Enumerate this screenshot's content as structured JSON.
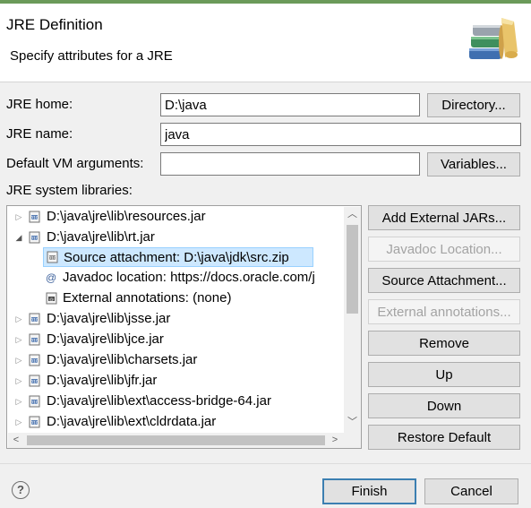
{
  "header": {
    "title": "JRE Definition",
    "subtitle": "Specify attributes for a JRE",
    "icon": "jre-books-icon"
  },
  "form": {
    "jre_home_label": "JRE home:",
    "jre_home_value": "D:\\java",
    "directory_button": "Directory...",
    "jre_name_label": "JRE name:",
    "jre_name_value": "java",
    "vm_args_label": "Default VM arguments:",
    "vm_args_value": "",
    "variables_button": "Variables..."
  },
  "libraries": {
    "label": "JRE system libraries:",
    "items": [
      {
        "text": "D:\\java\\jre\\lib\\resources.jar",
        "expanded": false
      },
      {
        "text": "D:\\java\\jre\\lib\\rt.jar",
        "expanded": true
      },
      {
        "text": "Source attachment: D:\\java\\jdk\\src.zip",
        "child": true,
        "selected": true
      },
      {
        "text": "Javadoc location: https://docs.oracle.com/j",
        "child": true
      },
      {
        "text": "External annotations: (none)",
        "child": true
      },
      {
        "text": "D:\\java\\jre\\lib\\jsse.jar",
        "expanded": false
      },
      {
        "text": "D:\\java\\jre\\lib\\jce.jar",
        "expanded": false
      },
      {
        "text": "D:\\java\\jre\\lib\\charsets.jar",
        "expanded": false
      },
      {
        "text": "D:\\java\\jre\\lib\\jfr.jar",
        "expanded": false
      },
      {
        "text": "D:\\java\\jre\\lib\\ext\\access-bridge-64.jar",
        "expanded": false
      },
      {
        "text": "D:\\java\\jre\\lib\\ext\\cldrdata.jar",
        "expanded": false
      }
    ]
  },
  "side_buttons": {
    "add_external_jars": "Add External JARs...",
    "javadoc_location": "Javadoc Location...",
    "source_attachment": "Source Attachment...",
    "external_annotations": "External annotations...",
    "remove": "Remove",
    "up": "Up",
    "down": "Down",
    "restore_default": "Restore Default"
  },
  "footer": {
    "help_icon": "help-icon",
    "finish": "Finish",
    "cancel": "Cancel"
  },
  "colors": {
    "selection_bg": "#cde8ff",
    "selection_border": "#99d1ff",
    "default_button_border": "#3c7fb1"
  }
}
